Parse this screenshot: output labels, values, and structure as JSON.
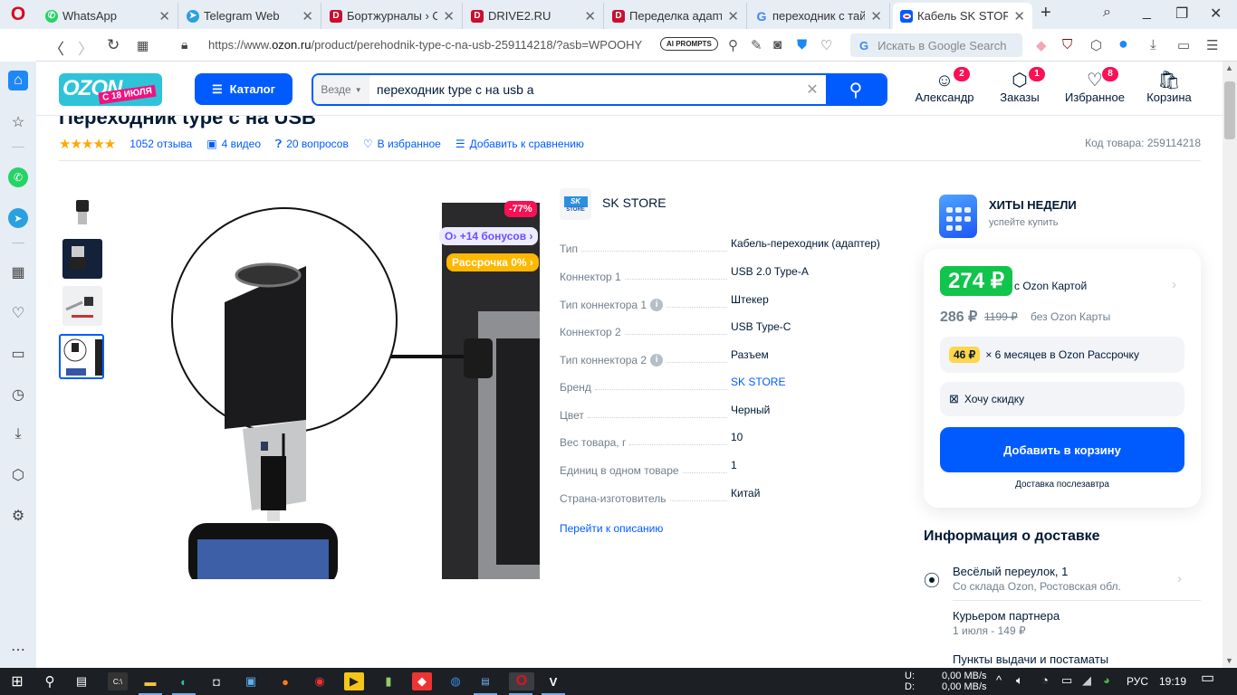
{
  "browser": {
    "tabs": [
      {
        "label": "WhatsApp",
        "icon": "whatsapp-icon",
        "color": "#25d366"
      },
      {
        "label": "Telegram Web",
        "icon": "telegram-icon",
        "color": "#2aa0e0"
      },
      {
        "label": "Бортжурналы › Ор",
        "icon": "drive2-icon",
        "color": "#c8102e"
      },
      {
        "label": "DRIVE2.RU",
        "icon": "drive2-icon",
        "color": "#c8102e"
      },
      {
        "label": "Переделка адаптер",
        "icon": "drive2-icon",
        "color": "#c8102e"
      },
      {
        "label": "переходник с тайп",
        "icon": "google-icon",
        "color": "#4285f4"
      },
      {
        "label": "Кабель SK STORE P",
        "icon": "ozon-icon",
        "color": "#005bff",
        "active": true
      }
    ],
    "url_prefix": "https://www.",
    "url_domain": "ozon.ru",
    "url_rest": "/product/perehodnik-type-c-na-usb-259114218/?asb=WPOOHY",
    "ai_prompts": "AI PROMPTS",
    "google_search_placeholder": "Искать в Google Search"
  },
  "ozon": {
    "logo_text": "OZON",
    "logo_promo": "С 18 ИЮЛЯ",
    "catalog_label": "Каталог",
    "search_scope": "Везде",
    "search_value": "переходник type c на usb a",
    "header_items": [
      {
        "label": "Александр",
        "icon": "profile-icon",
        "badge": "2"
      },
      {
        "label": "Заказы",
        "icon": "orders-box-icon",
        "badge": "1"
      },
      {
        "label": "Избранное",
        "icon": "heart-icon",
        "badge": "8"
      },
      {
        "label": "Корзина",
        "icon": "cart-bag-icon",
        "badge": ""
      }
    ]
  },
  "product": {
    "title": "Переходник type c на USB",
    "rating_stars": 5,
    "reviews": "1052 отзыва",
    "videos": "4 видео",
    "questions": "20 вопросов",
    "favorite": "В избранное",
    "compare": "Добавить к сравнению",
    "code": "Код товара: 259114218",
    "discount_badge": "-77%",
    "bonus_badge": "+14 бонусов",
    "installment_badge": "Рассрочка 0%",
    "seller": "SK STORE",
    "specs": [
      {
        "key": "Тип",
        "value": "Кабель-переходник (адаптер)"
      },
      {
        "key": "Коннектор 1",
        "value": "USB 2.0 Type-A"
      },
      {
        "key": "Тип коннектора 1",
        "value": "Штекер",
        "info": true
      },
      {
        "key": "Коннектор 2",
        "value": "USB Type-C"
      },
      {
        "key": "Тип коннектора 2",
        "value": "Разъем",
        "info": true
      },
      {
        "key": "Бренд",
        "value": "SK STORE",
        "link": true
      },
      {
        "key": "Цвет",
        "value": "Черный"
      },
      {
        "key": "Вес товара, г",
        "value": "10"
      },
      {
        "key": "Единиц в одном товаре",
        "value": "1"
      },
      {
        "key": "Страна-изготовитель",
        "value": "Китай"
      }
    ],
    "goto_description": "Перейти к описанию"
  },
  "sidebar_promo": {
    "title": "ХИТЫ НЕДЕЛИ",
    "subtitle": "успейте купить"
  },
  "price": {
    "card_price": "274 ₽",
    "card_label": "с Ozon Картой",
    "regular_price": "286 ₽",
    "old_price": "1199 ₽",
    "regular_label": "без Ozon Карты",
    "installment_amount": "46 ₽",
    "installment_text": "× 6 месяцев в Ozon Рассрочку",
    "want_discount": "Хочу скидку",
    "add_to_cart": "Добавить в корзину",
    "delivery_when": "Доставка послезавтра"
  },
  "delivery": {
    "title": "Информация о доставке",
    "address": "Весёлый переулок, 1",
    "address_sub": "Со склада Ozon, Ростовская обл.",
    "courier": "Курьером партнера",
    "courier_sub": "1 июля - 149 ₽",
    "pickup": "Пункты выдачи и постаматы"
  },
  "taskbar": {
    "net_up_label": "U:",
    "net_down_label": "D:",
    "net_up": "0,00 MB/s",
    "net_down": "0,00 MB/s",
    "lang": "РУС",
    "time": "19:19"
  }
}
